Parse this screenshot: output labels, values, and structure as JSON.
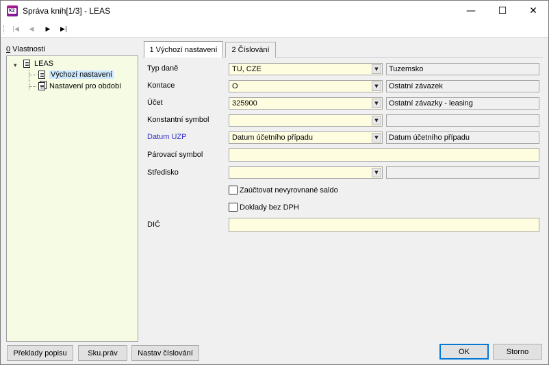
{
  "window": {
    "title": "Správa knih[1/3] - LEAS",
    "app_icon_text": "K2",
    "minimize_glyph": "—",
    "maximize_glyph": "☐",
    "close_glyph": "✕"
  },
  "toolbar": {
    "first_glyph": "|◀",
    "prev_glyph": "◀",
    "next_glyph": "▶",
    "last_glyph": "▶|"
  },
  "left_panel": {
    "label_accel": "0",
    "label_rest": " Vlastnosti",
    "tree": {
      "toggle_glyph": "▾",
      "root": "LEAS",
      "children": [
        "Výchozí nastavení",
        "Nastavení pro období"
      ]
    },
    "buttons": [
      "Překlady popisu",
      "Sku.práv",
      "Nastav číslování"
    ]
  },
  "tabs": [
    {
      "label": "1 Výchozí nastavení",
      "active": true
    },
    {
      "label": "2 Číslování",
      "active": false
    }
  ],
  "form": {
    "typ_dane": {
      "label": "Typ daně",
      "value": "TU, CZE",
      "desc": "Tuzemsko"
    },
    "kontace": {
      "label": "Kontace",
      "value": "O",
      "desc": "Ostatní závazek"
    },
    "ucet": {
      "label": "Účet",
      "value": "325900",
      "desc": "Ostatní závazky - leasing"
    },
    "konstantni_symbol": {
      "label": "Konstantní symbol",
      "value": "",
      "desc": ""
    },
    "datum_uzp": {
      "label": "Datum UZP",
      "value": "Datum účetního případu",
      "desc": "Datum účetního případu",
      "label_color": "#2f2fc8"
    },
    "parovaci_symbol": {
      "label": "Párovací symbol",
      "value": ""
    },
    "stredisko": {
      "label": "Středisko",
      "value": "",
      "desc": ""
    },
    "zauctovat": {
      "label": "Zaúčtovat nevyrovnané saldo",
      "checked": false
    },
    "doklady": {
      "label": "Doklady bez DPH",
      "checked": false
    },
    "dic": {
      "label": "DIČ",
      "value": ""
    },
    "combo_glyph": "▼"
  },
  "dialog_buttons": {
    "ok": "OK",
    "cancel": "Storno"
  },
  "colors": {
    "field_bg": "#fffde0",
    "tree_bg": "#f6fbe3",
    "selection": "#cde8ff",
    "accent": "#0078d7"
  }
}
